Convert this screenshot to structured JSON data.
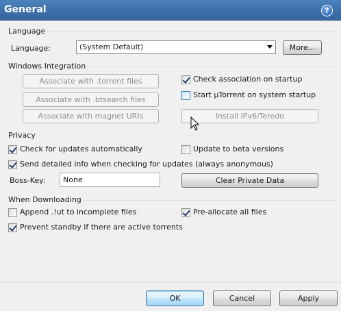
{
  "header": {
    "title": "General",
    "help_icon": "help-icon"
  },
  "language_group": {
    "title": "Language",
    "label": "Language:",
    "selected": "(System Default)",
    "more_button": "More..."
  },
  "windows_group": {
    "title": "Windows Integration",
    "associate_torrent": "Associate with .torrent files",
    "associate_btsearch": "Associate with .btsearch files",
    "associate_magnet": "Associate with magnet URIs",
    "check_association": {
      "label": "Check association on startup",
      "checked": true
    },
    "start_on_startup": {
      "label": "Start µTorrent on system startup",
      "checked": false
    },
    "install_ipv6": "Install IPv6/Teredo"
  },
  "privacy_group": {
    "title": "Privacy",
    "check_updates": {
      "label": "Check for updates automatically",
      "checked": true
    },
    "beta_versions": {
      "label": "Update to beta versions",
      "checked": false
    },
    "send_info": {
      "label": "Send detailed info when checking for updates (always anonymous)",
      "checked": true
    },
    "boss_key_label": "Boss-Key:",
    "boss_key_value": "None",
    "clear_private": "Clear Private Data"
  },
  "downloading_group": {
    "title": "When Downloading",
    "append_ut": {
      "label": "Append .!ut to incomplete files",
      "checked": false
    },
    "preallocate": {
      "label": "Pre-allocate all files",
      "checked": true
    },
    "prevent_standby": {
      "label": "Prevent standby if there are active torrents",
      "checked": true
    }
  },
  "footer": {
    "ok": "OK",
    "cancel": "Cancel",
    "apply": "Apply"
  }
}
